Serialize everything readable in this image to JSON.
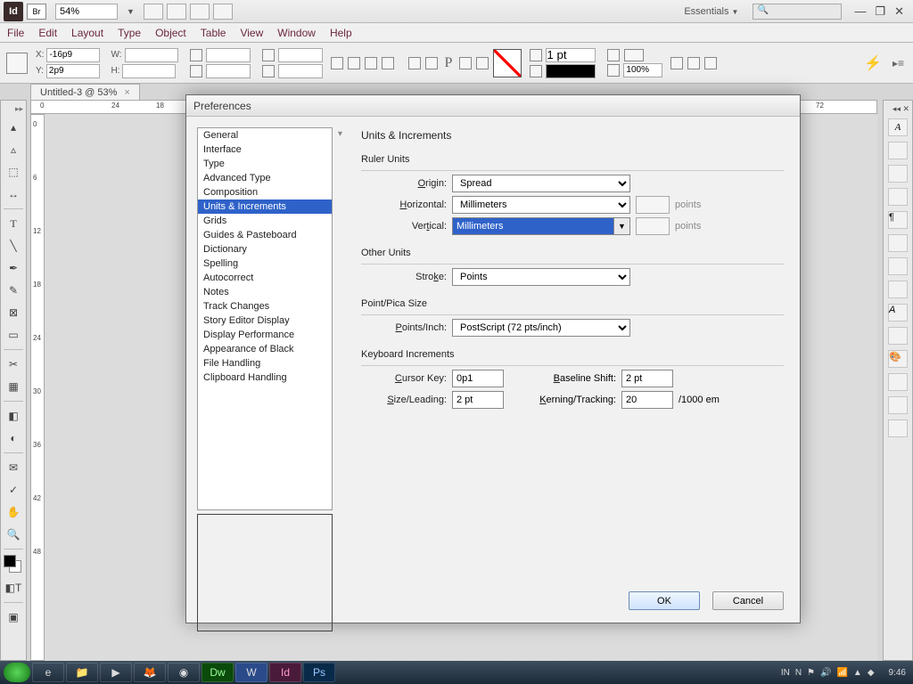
{
  "appbar": {
    "logo": "Id",
    "br": "Br",
    "zoom": "54%",
    "workspace": "Essentials",
    "win": {
      "min": "—",
      "max": "❐",
      "close": "✕"
    }
  },
  "menubar": [
    "File",
    "Edit",
    "Layout",
    "Type",
    "Object",
    "Table",
    "View",
    "Window",
    "Help"
  ],
  "ctrl": {
    "x_label": "X:",
    "x_val": "-16p9",
    "y_label": "Y:",
    "y_val": "2p9",
    "w_label": "W:",
    "h_label": "H:",
    "stroke_val": "1 pt",
    "pct_val": "100%"
  },
  "tab": {
    "label": "Untitled-3 @ 53%",
    "close": "×"
  },
  "hruler_marks": {
    "m1": {
      "v": "0",
      "l": 10
    },
    "m2": {
      "v": "24",
      "l": 90
    },
    "m3": {
      "v": "18",
      "l": 140
    },
    "m4": {
      "v": "72",
      "l": 910
    }
  },
  "vruler_marks": [
    "0",
    "6",
    "12",
    "18",
    "24",
    "30",
    "36",
    "42",
    "48"
  ],
  "dialog": {
    "title": "Preferences",
    "categories": [
      "General",
      "Interface",
      "Type",
      "Advanced Type",
      "Composition",
      "Units & Increments",
      "Grids",
      "Guides & Pasteboard",
      "Dictionary",
      "Spelling",
      "Autocorrect",
      "Notes",
      "Track Changes",
      "Story Editor Display",
      "Display Performance",
      "Appearance of Black",
      "File Handling",
      "Clipboard Handling"
    ],
    "selected_index": 5,
    "heading": "Units & Increments",
    "ruler": {
      "title": "Ruler Units",
      "origin_label": "Origin:",
      "origin_value": "Spread",
      "horiz_label": "Horizontal:",
      "horiz_value": "Millimeters",
      "vert_label": "Vertical:",
      "vert_value": "Millimeters",
      "points_unit": "points"
    },
    "other": {
      "title": "Other Units",
      "stroke_label": "Stroke:",
      "stroke_value": "Points"
    },
    "pica": {
      "title": "Point/Pica Size",
      "label": "Points/Inch:",
      "value": "PostScript (72 pts/inch)"
    },
    "kb": {
      "title": "Keyboard Increments",
      "cursor_label": "Cursor Key:",
      "cursor_value": "0p1",
      "baseline_label": "Baseline Shift:",
      "baseline_value": "2 pt",
      "size_label": "Size/Leading:",
      "size_value": "2 pt",
      "kern_label": "Kerning/Tracking:",
      "kern_value": "20",
      "kern_unit": "/1000 em"
    },
    "ok": "OK",
    "cancel": "Cancel"
  },
  "taskbar": {
    "lang": "IN",
    "time": "9:46"
  }
}
